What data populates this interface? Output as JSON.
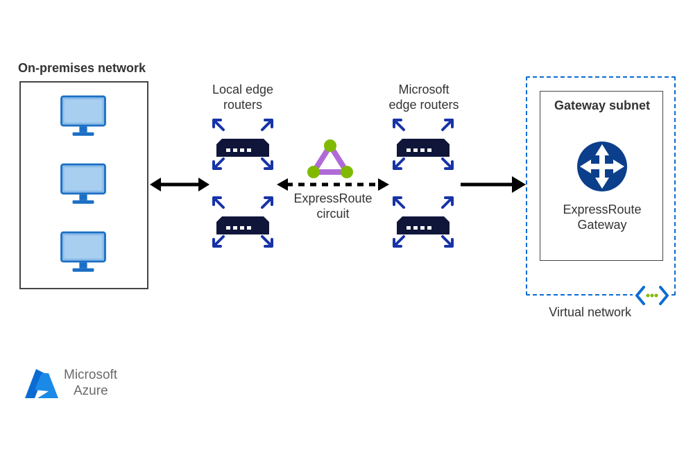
{
  "diagram": {
    "onprem_title": "On-premises network",
    "local_edge_label_1": "Local edge",
    "local_edge_label_2": "routers",
    "ms_edge_label_1": "Microsoft",
    "ms_edge_label_2": "edge routers",
    "circuit_label_1": "ExpressRoute",
    "circuit_label_2": "circuit",
    "gateway_subnet_title": "Gateway subnet",
    "gateway_label_1": "ExpressRoute",
    "gateway_label_2": "Gateway",
    "vnet_label": "Virtual network",
    "brand_1": "Microsoft",
    "brand_2": "Azure"
  }
}
